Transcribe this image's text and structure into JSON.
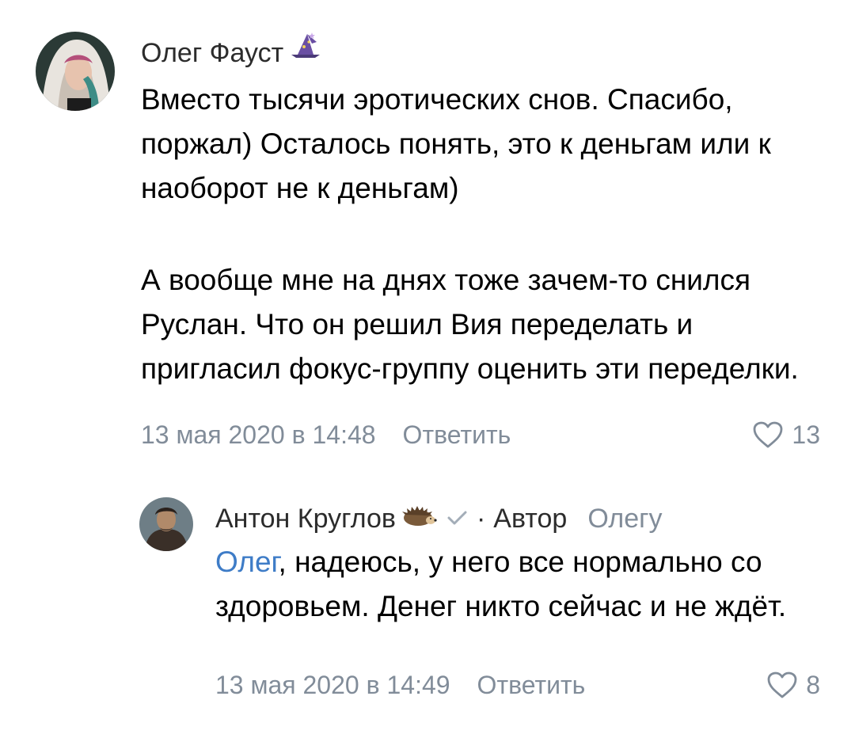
{
  "comments": [
    {
      "author": "Олег Фауст",
      "author_emoji": "wizard-hat-emoji",
      "paragraphs": [
        "Вместо тысячи эротических снов. Спасибо, поржал) Осталось понять, это к деньгам или к наоборот не к деньгам)",
        "А вообще мне на днях тоже зачем-то снился Руслан. Что он решил Вия переделать и пригласил фокус-группу оценить эти переделки."
      ],
      "date": "13 мая 2020 в 14:48",
      "reply_label": "Ответить",
      "likes": "13"
    },
    {
      "author": "Антон Круглов",
      "author_emoji": "hedgehog-emoji",
      "verified_icon": "check-icon",
      "separator": "·",
      "author_tag": "Автор",
      "reply_to": "Олегу",
      "mention": "Олег",
      "text_after_mention": ", надеюсь, у него все нормально со здоровьем. Денег никто сейчас и не ждёт.",
      "date": "13 мая 2020 в 14:49",
      "reply_label": "Ответить",
      "likes": "8"
    }
  ],
  "colors": {
    "meta": "#818c99",
    "mention": "#3e7cc7",
    "text": "#000000"
  }
}
